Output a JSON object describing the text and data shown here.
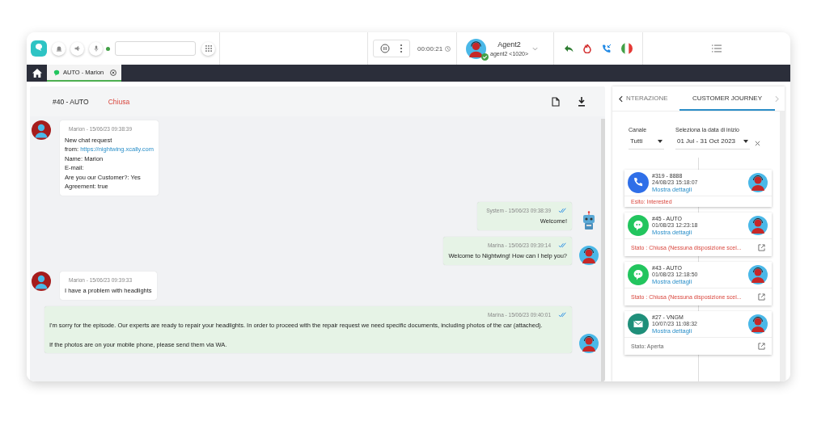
{
  "toolbar": {
    "presence_online": true,
    "timer": "00:00:21",
    "agent": {
      "name": "Agent2",
      "extension": "agent2 <1020>",
      "available": true
    }
  },
  "tabs": [
    {
      "label": "AUTO - Marion",
      "selected": true
    }
  ],
  "chat": {
    "title": "#40 - AUTO",
    "status": "Chiusa",
    "messages": [
      {
        "kind": "customer",
        "meta": "Marion - 15/06/23 09:38:39",
        "lines": [
          {
            "text": "New chat request"
          },
          {
            "text": "from:",
            "link": "https://nightwing.xcally.com"
          },
          {
            "text": "Name: Marion"
          },
          {
            "text": "E-mail:"
          },
          {
            "text": "Are you our Customer?: Yes"
          },
          {
            "text": "Agreement: true"
          }
        ]
      },
      {
        "kind": "bot",
        "meta": "System - 15/06/23 09:38:39",
        "read": true,
        "lines": [
          {
            "text": "Welcome!"
          }
        ]
      },
      {
        "kind": "agent",
        "meta": "Marina - 15/06/23 09:39:14",
        "read": true,
        "lines": [
          {
            "text": "Welcome to Nightwing! How can I help you?"
          }
        ]
      },
      {
        "kind": "customer",
        "meta": "Marion - 15/06/23 09:39:33",
        "lines": [
          {
            "text": "I have a problem with headlights"
          }
        ]
      },
      {
        "kind": "agent",
        "meta": "Marina - 15/06/23 09:40:01",
        "read": true,
        "wide": true,
        "lines": [
          {
            "text": "I'm sorry for the episode. Our experts are ready to repair your headlights. In order to proceed with the repair request we need specific documents, including photos of the car (attached)."
          },
          {
            "text": "If the photos are on your mobile phone, please send them via WA."
          }
        ]
      }
    ]
  },
  "side_panel": {
    "tabs": [
      {
        "label": "NTERAZIONE",
        "selected": false
      },
      {
        "label": "CUSTOMER JOURNEY",
        "selected": true
      }
    ],
    "filters": [
      {
        "label": "Canale",
        "value": "Tutti",
        "clearable": false
      },
      {
        "label": "Seleziona la data di inizio",
        "value": "01 Jul - 31 Oct 2023",
        "clearable": true
      }
    ],
    "journey": [
      {
        "kind": "phone",
        "title": "#319 - 8888",
        "date": "24/08/23 15:18:07",
        "link": "Mostra dettagli",
        "footer": "Esito: Interested",
        "alert": true,
        "openable": false
      },
      {
        "kind": "chat",
        "title": "#45 - AUTO",
        "date": "01/08/23 12:23:18",
        "link": "Mostra dettagli",
        "footer": "Stato : Chiusa (Nessuna disposizione scel...",
        "alert": true,
        "openable": true
      },
      {
        "kind": "chat",
        "title": "#43 - AUTO",
        "date": "01/08/23 12:18:50",
        "link": "Mostra dettagli",
        "footer": "Stato : Chiusa (Nessuna disposizione scel...",
        "alert": true,
        "openable": true
      },
      {
        "kind": "email",
        "title": "#27 - VNGM",
        "date": "10/07/23 11:08:32",
        "link": "Mostra dettagli",
        "footer": "Stato: Aperta",
        "alert": false,
        "openable": true
      }
    ]
  }
}
